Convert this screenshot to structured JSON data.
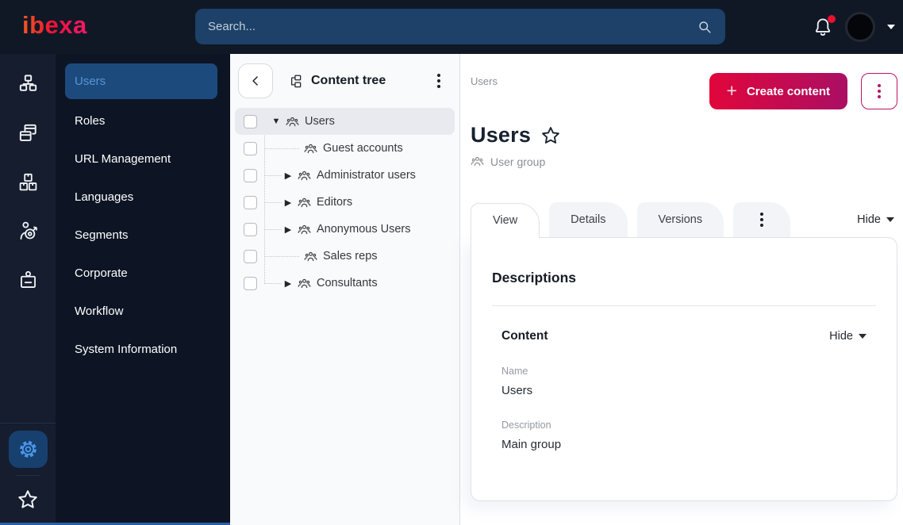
{
  "colors": {
    "topbar_bg": "#101826",
    "rail_bg": "#151d2e",
    "menu_bg": "#0d1524",
    "search_bg": "#1d4168",
    "selected_menu_bg": "#1d4a7c",
    "selected_menu_text": "#5795d6",
    "button_gradient_start": "#e1063b",
    "button_gradient_end": "#aa0f64",
    "accent_magenta": "#b3126a",
    "notification_red": "#e8112d",
    "gear_blue": "#4b96e8"
  },
  "topbar": {
    "logo_text": "ibexa",
    "search_placeholder": "Search...",
    "icons": [
      "search-icon",
      "bell-icon",
      "avatar",
      "caret-down-icon"
    ],
    "notification_badge": true
  },
  "icon_rail": {
    "items": [
      "content-structure-icon",
      "pages-icon",
      "catalog-boxes-icon",
      "audience-target-icon",
      "id-badge-icon"
    ],
    "bottom_items": [
      "gear-icon",
      "star-icon"
    ]
  },
  "menu": {
    "items": [
      {
        "label": "Users",
        "active": true
      },
      {
        "label": "Roles"
      },
      {
        "label": "URL Management"
      },
      {
        "label": "Languages"
      },
      {
        "label": "Segments"
      },
      {
        "label": "Corporate"
      },
      {
        "label": "Workflow"
      },
      {
        "label": "System Information"
      }
    ]
  },
  "content_tree": {
    "title": "Content tree",
    "items": [
      {
        "label": "Users",
        "depth": 0,
        "expanded": true,
        "selected": true,
        "has_children": true
      },
      {
        "label": "Guest accounts",
        "depth": 1,
        "has_children": false
      },
      {
        "label": "Administrator users",
        "depth": 1,
        "has_children": true
      },
      {
        "label": "Editors",
        "depth": 1,
        "has_children": true
      },
      {
        "label": "Anonymous Users",
        "depth": 1,
        "has_children": true
      },
      {
        "label": "Sales reps",
        "depth": 1,
        "has_children": false
      },
      {
        "label": "Consultants",
        "depth": 1,
        "has_children": true
      }
    ]
  },
  "main": {
    "breadcrumb": "Users",
    "create_button_label": "Create content",
    "title": "Users",
    "content_type": "User group",
    "tabs": [
      {
        "label": "View",
        "active": true
      },
      {
        "label": "Details"
      },
      {
        "label": "Versions"
      }
    ],
    "collapse_label": "Hide",
    "descriptions": {
      "heading": "Descriptions",
      "content_section": {
        "heading": "Content",
        "collapse_label": "Hide",
        "fields": [
          {
            "label": "Name",
            "value": "Users"
          },
          {
            "label": "Description",
            "value": "Main group"
          }
        ]
      }
    }
  }
}
